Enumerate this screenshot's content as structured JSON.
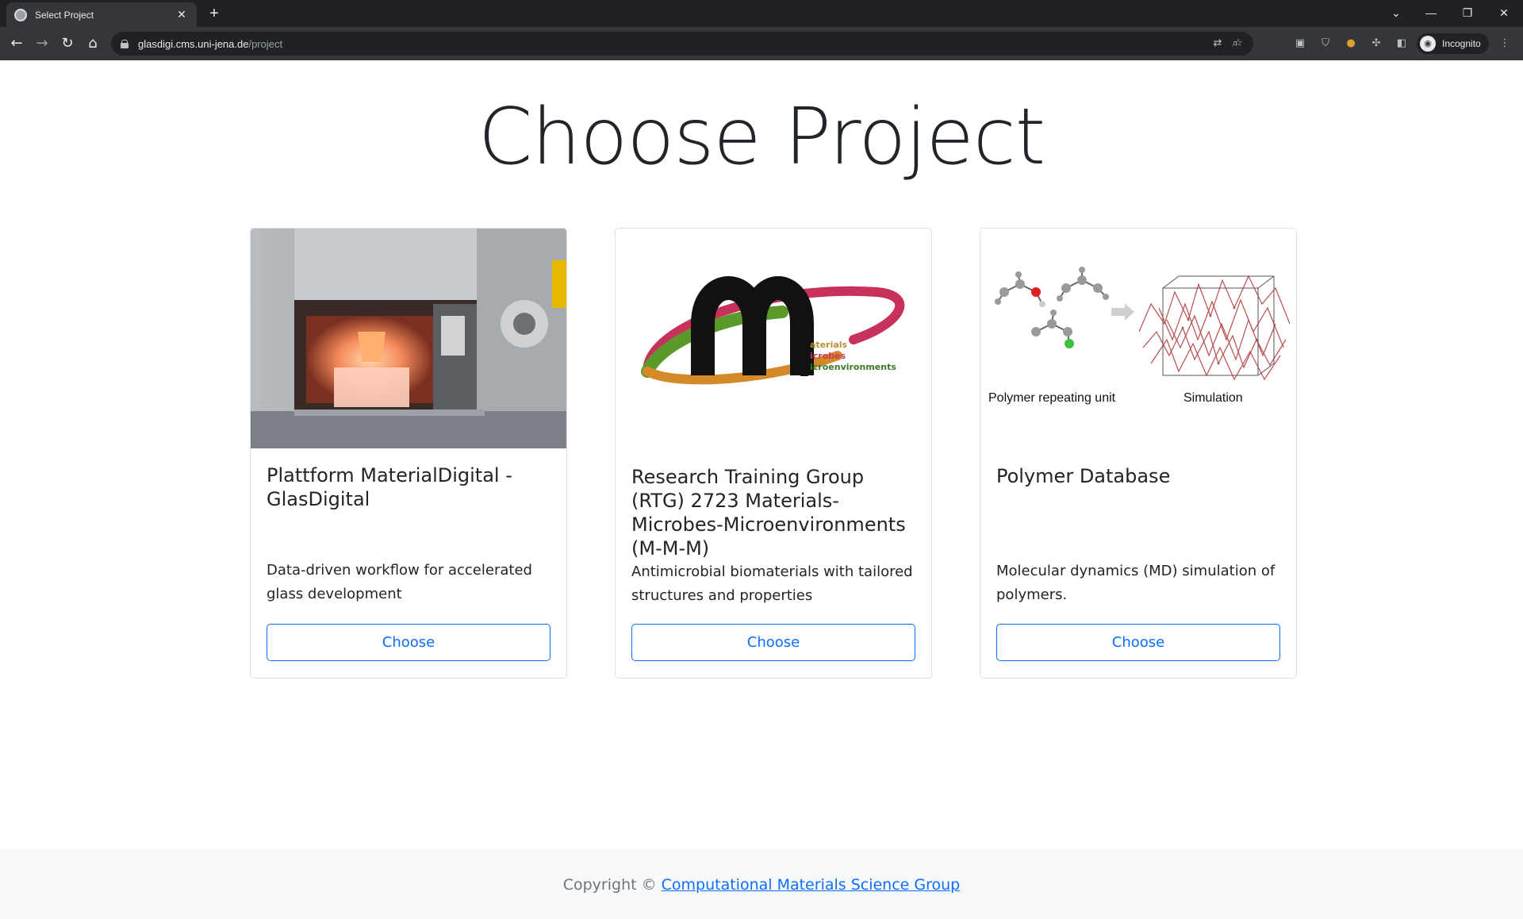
{
  "browser": {
    "tab_title": "Select Project",
    "tab_close": "✕",
    "new_tab": "+",
    "url_host": "glasdigi.cms.uni-jena.de",
    "url_path": "/project",
    "profile_label": "Incognito"
  },
  "page": {
    "title": "Choose Project"
  },
  "projects": [
    {
      "title": "Plattform MaterialDigital - GlasDigital",
      "description": "Data-driven workflow for accelerated glass development",
      "button": "Choose"
    },
    {
      "title": "Research Training Group (RTG) 2723 Materials-Microbes-Microenvironments (M-M-M)",
      "description": "Antimicrobial biomaterials with tailored structures and properties",
      "button": "Choose",
      "logo_lines": [
        "aterials",
        "icrobes",
        "icroenvironments"
      ]
    },
    {
      "title": "Polymer Database",
      "description": "Molecular dynamics (MD) simulation of polymers.",
      "button": "Choose",
      "image_labels": [
        "Polymer repeating unit",
        "Simulation"
      ]
    }
  ],
  "footer": {
    "prefix": "Copyright ©",
    "link": "Computational Materials Science Group"
  }
}
